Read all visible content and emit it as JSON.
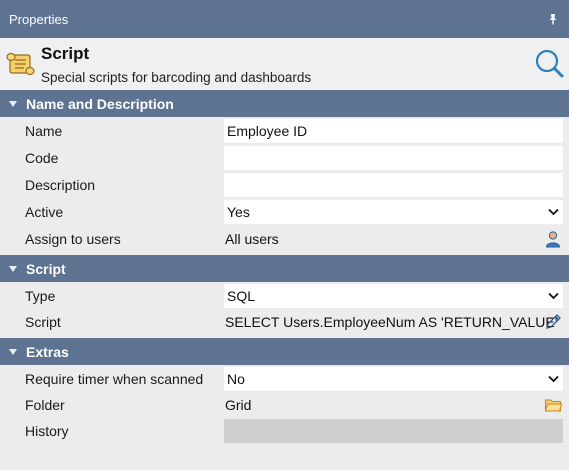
{
  "window": {
    "title": "Properties"
  },
  "header": {
    "title": "Script",
    "subtitle": "Special scripts for barcoding and dashboards"
  },
  "sections": {
    "name_desc": "Name and Description",
    "script": "Script",
    "extras": "Extras"
  },
  "fields": {
    "name": {
      "label": "Name",
      "value": "Employee ID"
    },
    "code": {
      "label": "Code",
      "value": ""
    },
    "description": {
      "label": "Description",
      "value": ""
    },
    "active": {
      "label": "Active",
      "value": "Yes"
    },
    "assign": {
      "label": "Assign to users",
      "value": "All users"
    },
    "type": {
      "label": "Type",
      "value": "SQL"
    },
    "script": {
      "label": "Script",
      "value": "SELECT Users.EmployeeNum AS 'RETURN_VALUE'"
    },
    "require_timer": {
      "label": "Require timer when scanned",
      "value": "No"
    },
    "folder": {
      "label": "Folder",
      "value": "Grid"
    },
    "history": {
      "label": "History",
      "value": ""
    }
  },
  "icons": {
    "pin": "pin-icon",
    "header": "scroll-icon",
    "search": "search-icon",
    "user": "user-icon",
    "edit": "pencil-icon",
    "folder": "folder-icon"
  },
  "colors": {
    "section_bg": "#5d7391",
    "header_bg": "#eef0f2",
    "row_bg": "#ececec",
    "input_bg": "#ffffff",
    "disabled_bg": "#cfcfcf"
  }
}
